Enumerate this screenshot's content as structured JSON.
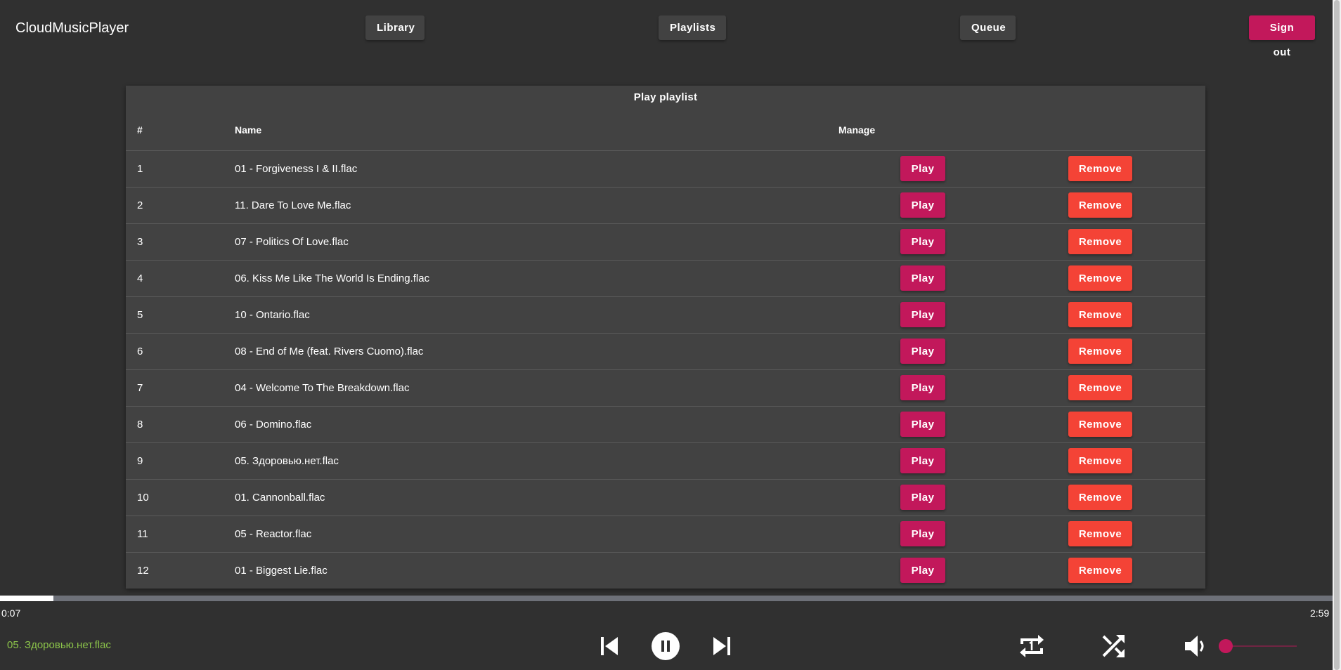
{
  "header": {
    "brand": "CloudMusicPlayer",
    "nav": {
      "library": "Library",
      "playlists": "Playlists",
      "queue": "Queue",
      "sign_out": "Sign out"
    }
  },
  "playlist": {
    "title": "Play playlist",
    "columns": {
      "number": "#",
      "name": "Name",
      "manage": "Manage"
    },
    "play_label": "Play",
    "remove_label": "Remove",
    "tracks": [
      {
        "num": "1",
        "name": "01 - Forgiveness I & II.flac"
      },
      {
        "num": "2",
        "name": "11. Dare To Love Me.flac"
      },
      {
        "num": "3",
        "name": "07 - Politics Of Love.flac"
      },
      {
        "num": "4",
        "name": "06. Kiss Me Like The World Is Ending.flac"
      },
      {
        "num": "5",
        "name": "10 - Ontario.flac"
      },
      {
        "num": "6",
        "name": "08 - End of Me (feat. Rivers Cuomo).flac"
      },
      {
        "num": "7",
        "name": "04 - Welcome To The Breakdown.flac"
      },
      {
        "num": "8",
        "name": "06 - Domino.flac"
      },
      {
        "num": "9",
        "name": "05. Здоровью.нет.flac"
      },
      {
        "num": "10",
        "name": "01. Cannonball.flac"
      },
      {
        "num": "11",
        "name": "05 - Reactor.flac"
      },
      {
        "num": "12",
        "name": "01 - Biggest Lie.flac"
      }
    ]
  },
  "player": {
    "current_time": "0:07",
    "total_time": "2:59",
    "progress_fraction": 0.04,
    "now_playing": "05. Здоровью.нет.flac",
    "volume_fraction": 0.0,
    "icons": [
      "skip-previous-icon",
      "pause-icon",
      "skip-next-icon",
      "repeat-one-icon",
      "shuffle-icon",
      "volume-icon"
    ]
  },
  "colors": {
    "background": "#303030",
    "surface": "#424242",
    "accent": "#c2185b",
    "danger": "#f44336",
    "now_playing": "#8bc34a"
  }
}
